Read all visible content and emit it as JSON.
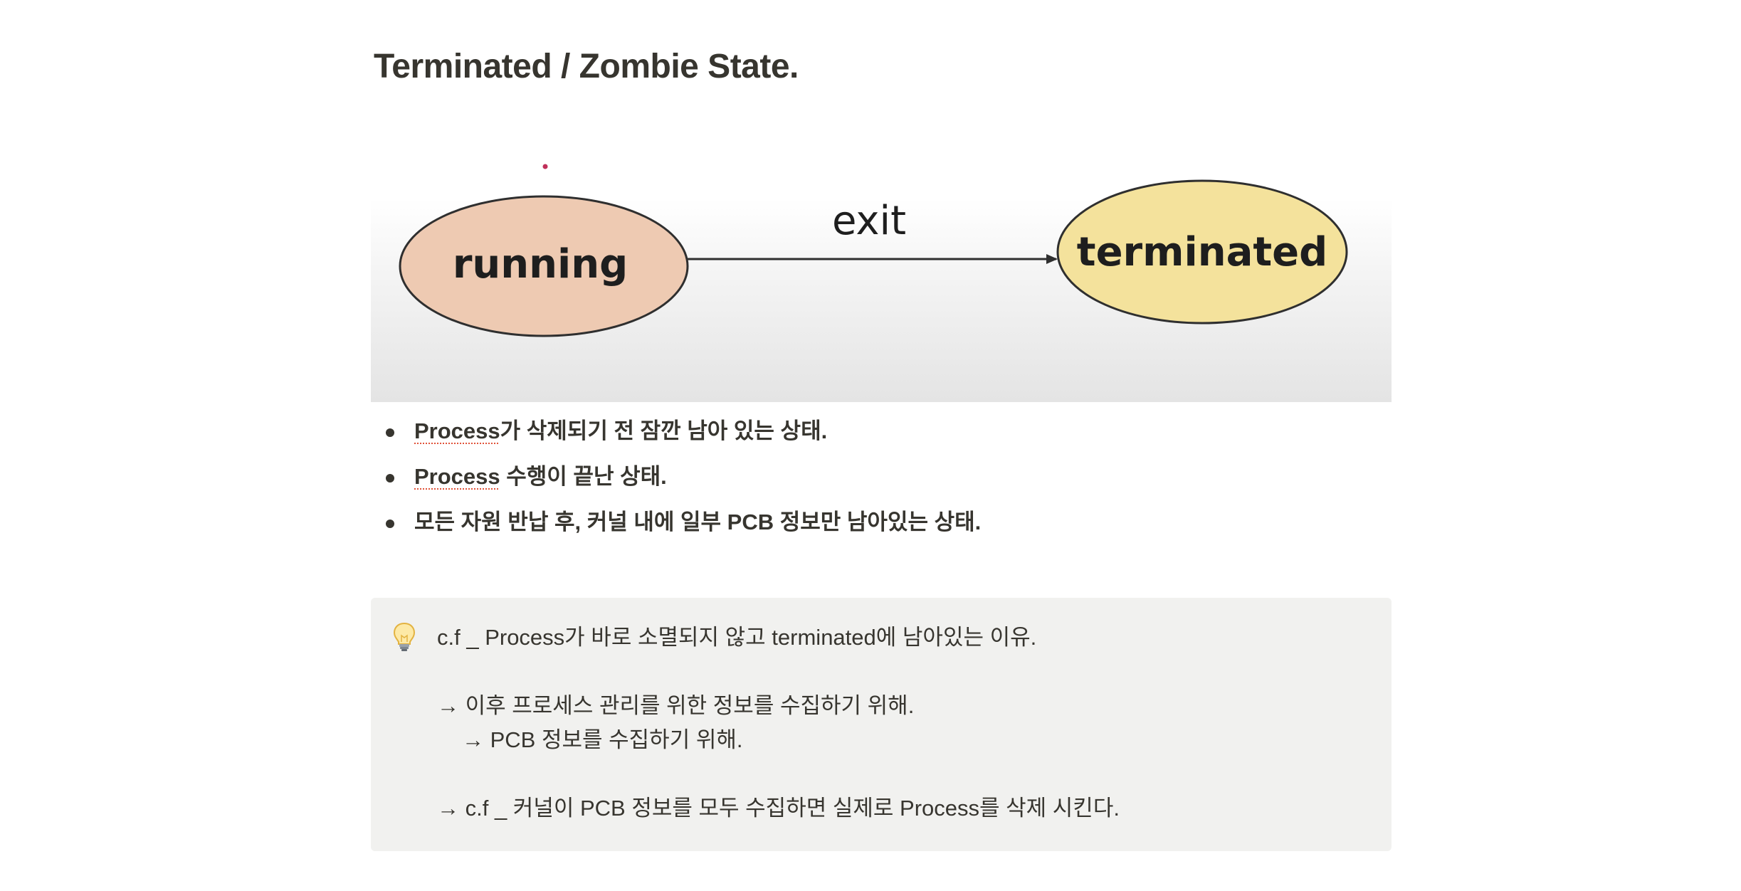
{
  "heading": "Terminated / Zombie State.",
  "diagram": {
    "source_state": "running",
    "edge_label": "exit",
    "target_state": "terminated",
    "colors": {
      "running_fill": "#eecab2",
      "terminated_fill": "#f4e29c",
      "stroke": "#2f2f2f"
    }
  },
  "bullets": [
    {
      "pre": "Process",
      "post": "가 삭제되기 전 잠깐 남아 있는 상태."
    },
    {
      "pre": "Process",
      "post": " 수행이 끝난 상태."
    },
    {
      "pre": "",
      "post": "모든 자원 반납 후, 커널 내에 일부 PCB 정보만 남아있는 상태."
    }
  ],
  "callout": {
    "icon": "lightbulb-icon",
    "title": "c.f _ Process가 바로 소멸되지 않고 terminated에 남아있는 이유.",
    "line1": "→ 이후 프로세스 관리를 위한 정보를 수집하기 위해.",
    "line2": "→ PCB 정보를 수집하기 위해.",
    "line3": "→ c.f _ 커널이 PCB 정보를 모두 수집하면 실제로 Process를 삭제 시킨다.",
    "background": "#f1f1ef"
  }
}
